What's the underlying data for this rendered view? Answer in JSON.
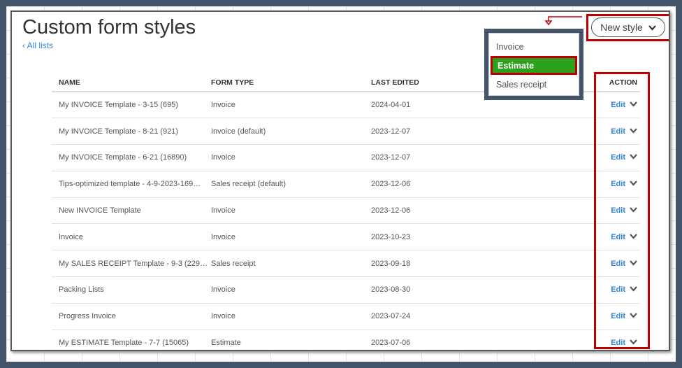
{
  "page": {
    "title": "Custom form styles",
    "back_link": "All lists"
  },
  "new_style": {
    "label": "New style",
    "menu": [
      "Invoice",
      "Estimate",
      "Sales receipt"
    ],
    "selected": "Estimate"
  },
  "table": {
    "headers": [
      "NAME",
      "FORM TYPE",
      "LAST EDITED",
      "ACTION"
    ],
    "rows": [
      {
        "name": "My INVOICE Template - 3-15 (695)",
        "type": "Invoice",
        "edited": "2024-04-01",
        "action": "Edit"
      },
      {
        "name": "My INVOICE Template - 8-21 (921)",
        "type": "Invoice (default)",
        "edited": "2023-12-07",
        "action": "Edit"
      },
      {
        "name": "My INVOICE Template - 6-21 (16890)",
        "type": "Invoice",
        "edited": "2023-12-07",
        "action": "Edit"
      },
      {
        "name": "Tips-optimized template - 4-9-2023-169…",
        "type": "Sales receipt (default)",
        "edited": "2023-12-06",
        "action": "Edit"
      },
      {
        "name": "New INVOICE Template",
        "type": "Invoice",
        "edited": "2023-12-06",
        "action": "Edit"
      },
      {
        "name": "Invoice",
        "type": "Invoice",
        "edited": "2023-10-23",
        "action": "Edit"
      },
      {
        "name": "My SALES RECEIPT Template - 9-3 (229…",
        "type": "Sales receipt",
        "edited": "2023-09-18",
        "action": "Edit"
      },
      {
        "name": "Packing Lists",
        "type": "Invoice",
        "edited": "2023-08-30",
        "action": "Edit"
      },
      {
        "name": "Progress Invoice",
        "type": "Invoice",
        "edited": "2023-07-24",
        "action": "Edit"
      },
      {
        "name": "My ESTIMATE Template - 7-7 (15065)",
        "type": "Estimate",
        "edited": "2023-07-06",
        "action": "Edit"
      }
    ]
  },
  "colors": {
    "accent": "#2ca01c",
    "highlight": "#c00000",
    "link": "#2e86de",
    "frame": "#44546a"
  }
}
